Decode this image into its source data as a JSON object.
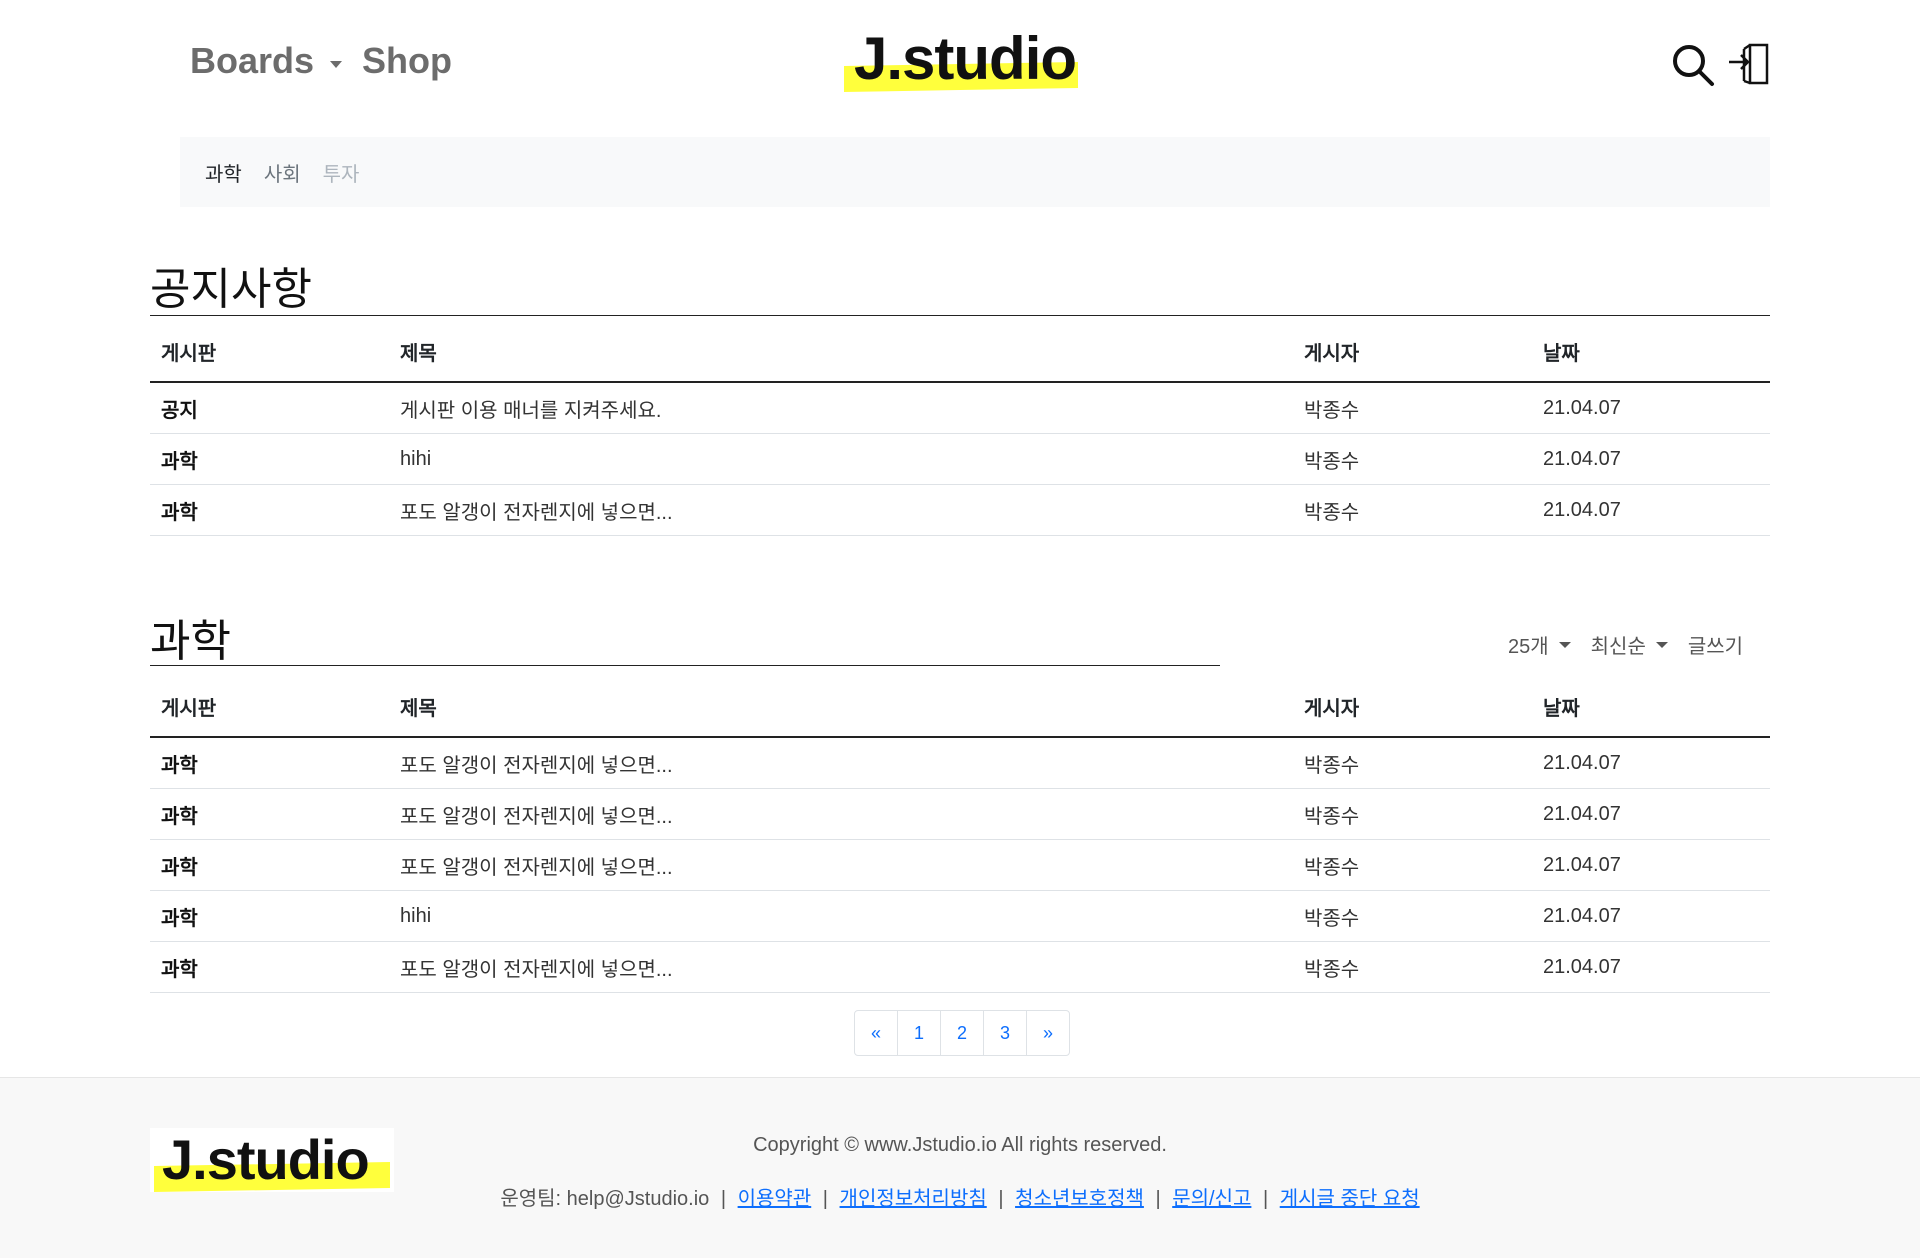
{
  "header": {
    "nav": {
      "boards": "Boards",
      "shop": "Shop"
    },
    "logo": "J.studio"
  },
  "categories": [
    "과학",
    "사회",
    "투자"
  ],
  "notice": {
    "title": "공지사항",
    "columns": [
      "게시판",
      "제목",
      "게시자",
      "날짜"
    ],
    "rows": [
      {
        "board": "공지",
        "title": "게시판 이용 매너를 지켜주세요.",
        "author": "박종수",
        "date": "21.04.07"
      },
      {
        "board": "과학",
        "title": "hihi",
        "author": "박종수",
        "date": "21.04.07"
      },
      {
        "board": "과학",
        "title": "포도 알갱이 전자렌지에 넣으면...",
        "author": "박종수",
        "date": "21.04.07"
      }
    ]
  },
  "science": {
    "title": "과학",
    "controls": {
      "per_page": "25개",
      "sort": "최신순",
      "write": "글쓰기"
    },
    "columns": [
      "게시판",
      "제목",
      "게시자",
      "날짜"
    ],
    "rows": [
      {
        "board": "과학",
        "title": "포도 알갱이 전자렌지에 넣으면...",
        "author": "박종수",
        "date": "21.04.07"
      },
      {
        "board": "과학",
        "title": "포도 알갱이 전자렌지에 넣으면...",
        "author": "박종수",
        "date": "21.04.07"
      },
      {
        "board": "과학",
        "title": "포도 알갱이 전자렌지에 넣으면...",
        "author": "박종수",
        "date": "21.04.07"
      },
      {
        "board": "과학",
        "title": "hihi",
        "author": "박종수",
        "date": "21.04.07"
      },
      {
        "board": "과학",
        "title": "포도 알갱이 전자렌지에 넣으면...",
        "author": "박종수",
        "date": "21.04.07"
      }
    ]
  },
  "pagination": [
    "«",
    "1",
    "2",
    "3",
    "»"
  ],
  "footer": {
    "logo": "J.studio",
    "copyright": "Copyright © www.Jstudio.io All rights reserved.",
    "contact": "운영팀: help@Jstudio.io",
    "links": [
      "이용약관",
      "개인정보처리방침",
      "청소년보호정책",
      "문의/신고",
      "게시글 중단 요청"
    ],
    "separator": "|"
  },
  "colors": {
    "highlight": "#ffff3c",
    "link": "#0d6efd",
    "footer_bg": "#f8f8f8"
  },
  "icons": [
    "search-icon",
    "login-icon"
  ]
}
